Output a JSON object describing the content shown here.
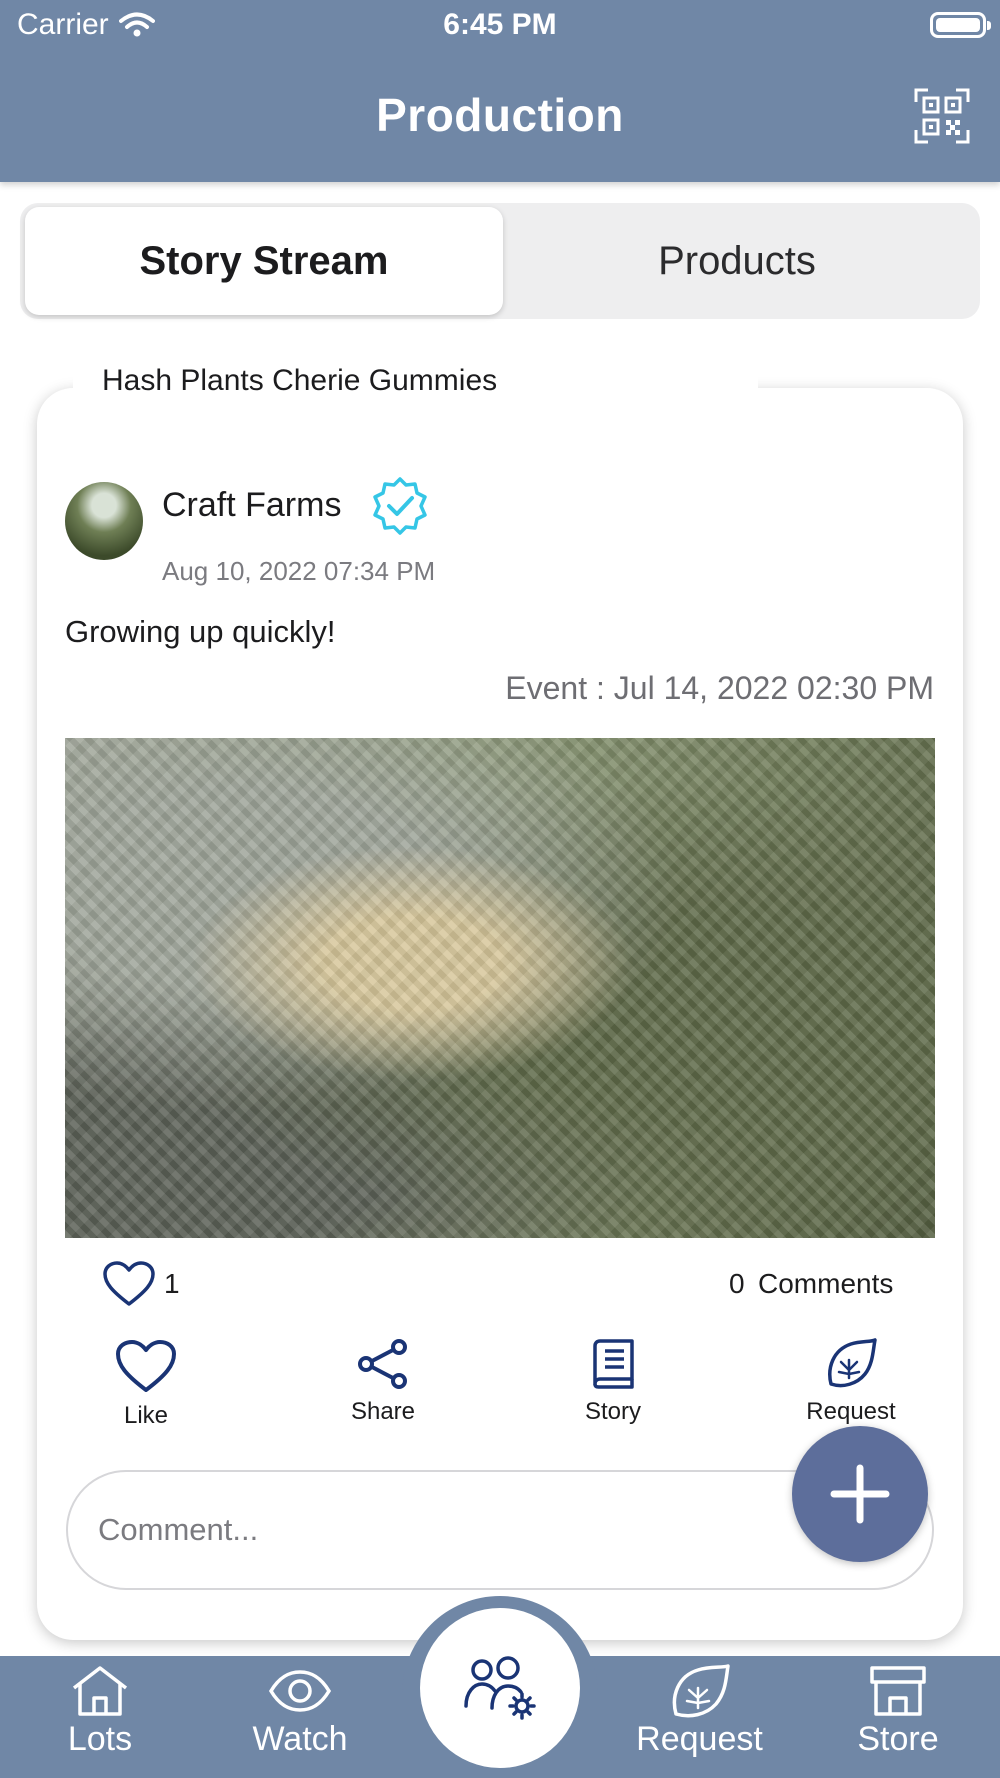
{
  "status_bar": {
    "carrier": "Carrier",
    "time": "6:45 PM"
  },
  "nav": {
    "title": "Production",
    "qr_icon": "qr-code-icon"
  },
  "segments": {
    "active": "Story Stream",
    "inactive": "Products"
  },
  "post": {
    "product_tab": "Hash Plants Cherie Gummies",
    "author": "Craft Farms",
    "date": "Aug 10, 2022 07:34 PM",
    "text": "Growing up quickly!",
    "event": "Event : Jul 14, 2022 02:30 PM",
    "like_count": "1",
    "comment_count": "0",
    "comment_label": "Comments",
    "actions": {
      "like": "Like",
      "share": "Share",
      "story": "Story",
      "request": "Request"
    },
    "comment_placeholder": "Comment..."
  },
  "tabs": {
    "lots": "Lots",
    "watch": "Watch",
    "request": "Request",
    "store": "Store"
  },
  "colors": {
    "bar": "#7087a6",
    "accent": "#1a3475",
    "fab": "#5d6e9b",
    "verified": "#35c6e6"
  }
}
